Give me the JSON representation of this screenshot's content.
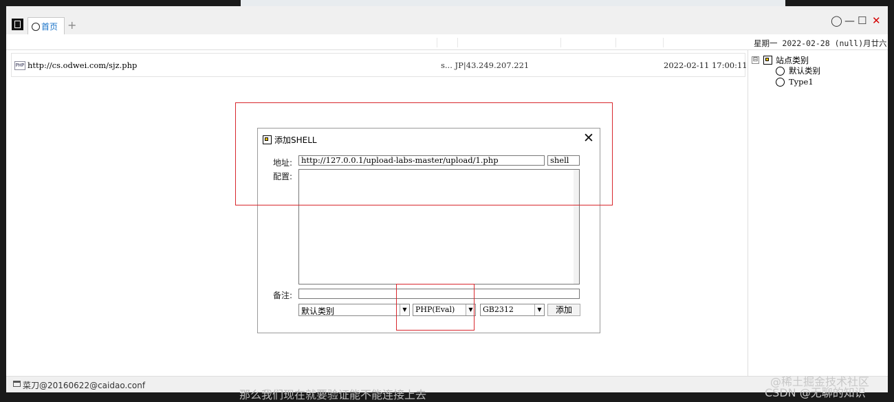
{
  "app": {
    "tabs": [
      {
        "label": "首页"
      }
    ],
    "add_tab_symbol": "+",
    "window_controls": {
      "record": "◯",
      "minimize": "—",
      "maximize": "☐",
      "close": "✕"
    },
    "close_color": "#d40000"
  },
  "date_bar": {
    "text": "星期一  2022-02-28 (null)月廿六"
  },
  "shell_list": {
    "rows": [
      {
        "type_icon": "PHP",
        "url": "http://cs.odwei.com/sjz.php",
        "ip": "s...  JP|43.249.207.221",
        "time": "2022-02-11 17:00:11"
      }
    ]
  },
  "category_tree": {
    "root": {
      "expander": "⊟",
      "label": "站点类别",
      "icon": "folder-icon"
    },
    "children": [
      {
        "label": "默认类别",
        "icon": "circle-icon"
      },
      {
        "label": "Type1",
        "icon": "circle-icon"
      }
    ]
  },
  "status_bar": {
    "text": "菜刀@20160622@caidao.conf"
  },
  "dialog": {
    "title": "添加SHELL",
    "close_symbol": "✕",
    "address_label": "地址:",
    "address_value": "http://127.0.0.1/upload-labs-master/upload/1.php",
    "password_value": "shell",
    "config_label": "配置:",
    "config_value": "",
    "note_label": "备注:",
    "note_value": "",
    "category_select": "默认类别",
    "script_type_select": "PHP(Eval)",
    "encoding_select": "GB2312",
    "add_button": "添加"
  },
  "highlight_color": "#d8262c",
  "overlay_caption": "那么我们现在就要验证能不能连接上去",
  "watermarks": [
    "@稀土掘金技术社区",
    "CSDN @无聊的知识"
  ]
}
